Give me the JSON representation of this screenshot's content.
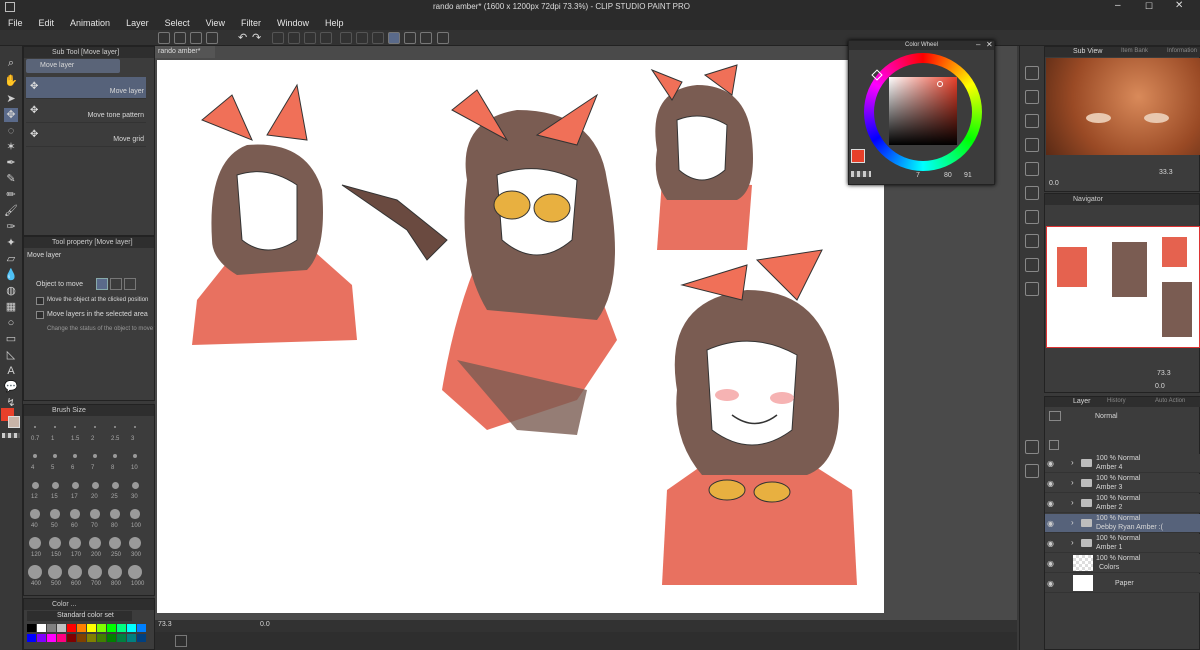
{
  "window": {
    "title": "rando amber* (1600 x 1200px 72dpi 73.3%)  - CLIP STUDIO PAINT PRO"
  },
  "menu": [
    "File",
    "Edit",
    "Animation",
    "Layer",
    "Select",
    "View",
    "Filter",
    "Window",
    "Help"
  ],
  "subtool": {
    "header": "Sub Tool [Move layer]",
    "tab": "Move layer",
    "items": [
      "Move layer",
      "Move tone pattern",
      "Move grid"
    ]
  },
  "toolprop": {
    "header": "Tool property [Move layer]",
    "name": "Move layer",
    "object_label": "Object to move",
    "options": [
      "Move the object at the clicked position",
      "Move layers in the selected area",
      "Change the status of the object to move to"
    ]
  },
  "brushsize": {
    "header": "Brush Size",
    "sizes": [
      "0.7",
      "1",
      "1.5",
      "2",
      "2.5",
      "3",
      "4",
      "5",
      "6",
      "7",
      "8",
      "10",
      "12",
      "15",
      "17",
      "20",
      "25",
      "30",
      "40",
      "50",
      "60",
      "70",
      "80",
      "100",
      "120",
      "150",
      "170",
      "200",
      "250",
      "300",
      "400",
      "500",
      "600",
      "700",
      "800",
      "1000"
    ]
  },
  "colorset": {
    "header": "Color ...",
    "name": "Standard color set"
  },
  "canvas": {
    "tab": "rando amber*",
    "zoom": "73.3",
    "angle": "0.0"
  },
  "colorwheel": {
    "title": "Color Wheel",
    "values": [
      "7",
      "80",
      "91"
    ],
    "hue_color": "#e8402a"
  },
  "subview": {
    "tabs": [
      "Sub View",
      "Item Bank",
      "Information"
    ],
    "zoom": "33.3",
    "angle": "0.0"
  },
  "navigator": {
    "title": "Navigator",
    "zoom": "73.3",
    "angle": "0.0"
  },
  "layers": {
    "tabs": [
      "Layer",
      "History",
      "Auto Action"
    ],
    "blend": "Normal",
    "items": [
      {
        "mode": "100 % Normal",
        "name": "Amber 4",
        "folder": true,
        "selected": false
      },
      {
        "mode": "100 % Normal",
        "name": "Amber 3",
        "folder": true,
        "selected": false
      },
      {
        "mode": "100 % Normal",
        "name": "Amber 2",
        "folder": true,
        "selected": false
      },
      {
        "mode": "100 % Normal",
        "name": "Debby Ryan Amber :(",
        "folder": true,
        "selected": true
      },
      {
        "mode": "100 % Normal",
        "name": "Amber 1",
        "folder": true,
        "selected": false
      },
      {
        "mode": "100 % Normal",
        "name": "Colors",
        "folder": false,
        "selected": false
      },
      {
        "mode": "",
        "name": "Paper",
        "folder": false,
        "selected": false
      }
    ]
  },
  "colors": {
    "main": "#e8402a",
    "sub": "#c8b4a8",
    "accent": "#e8402a"
  }
}
